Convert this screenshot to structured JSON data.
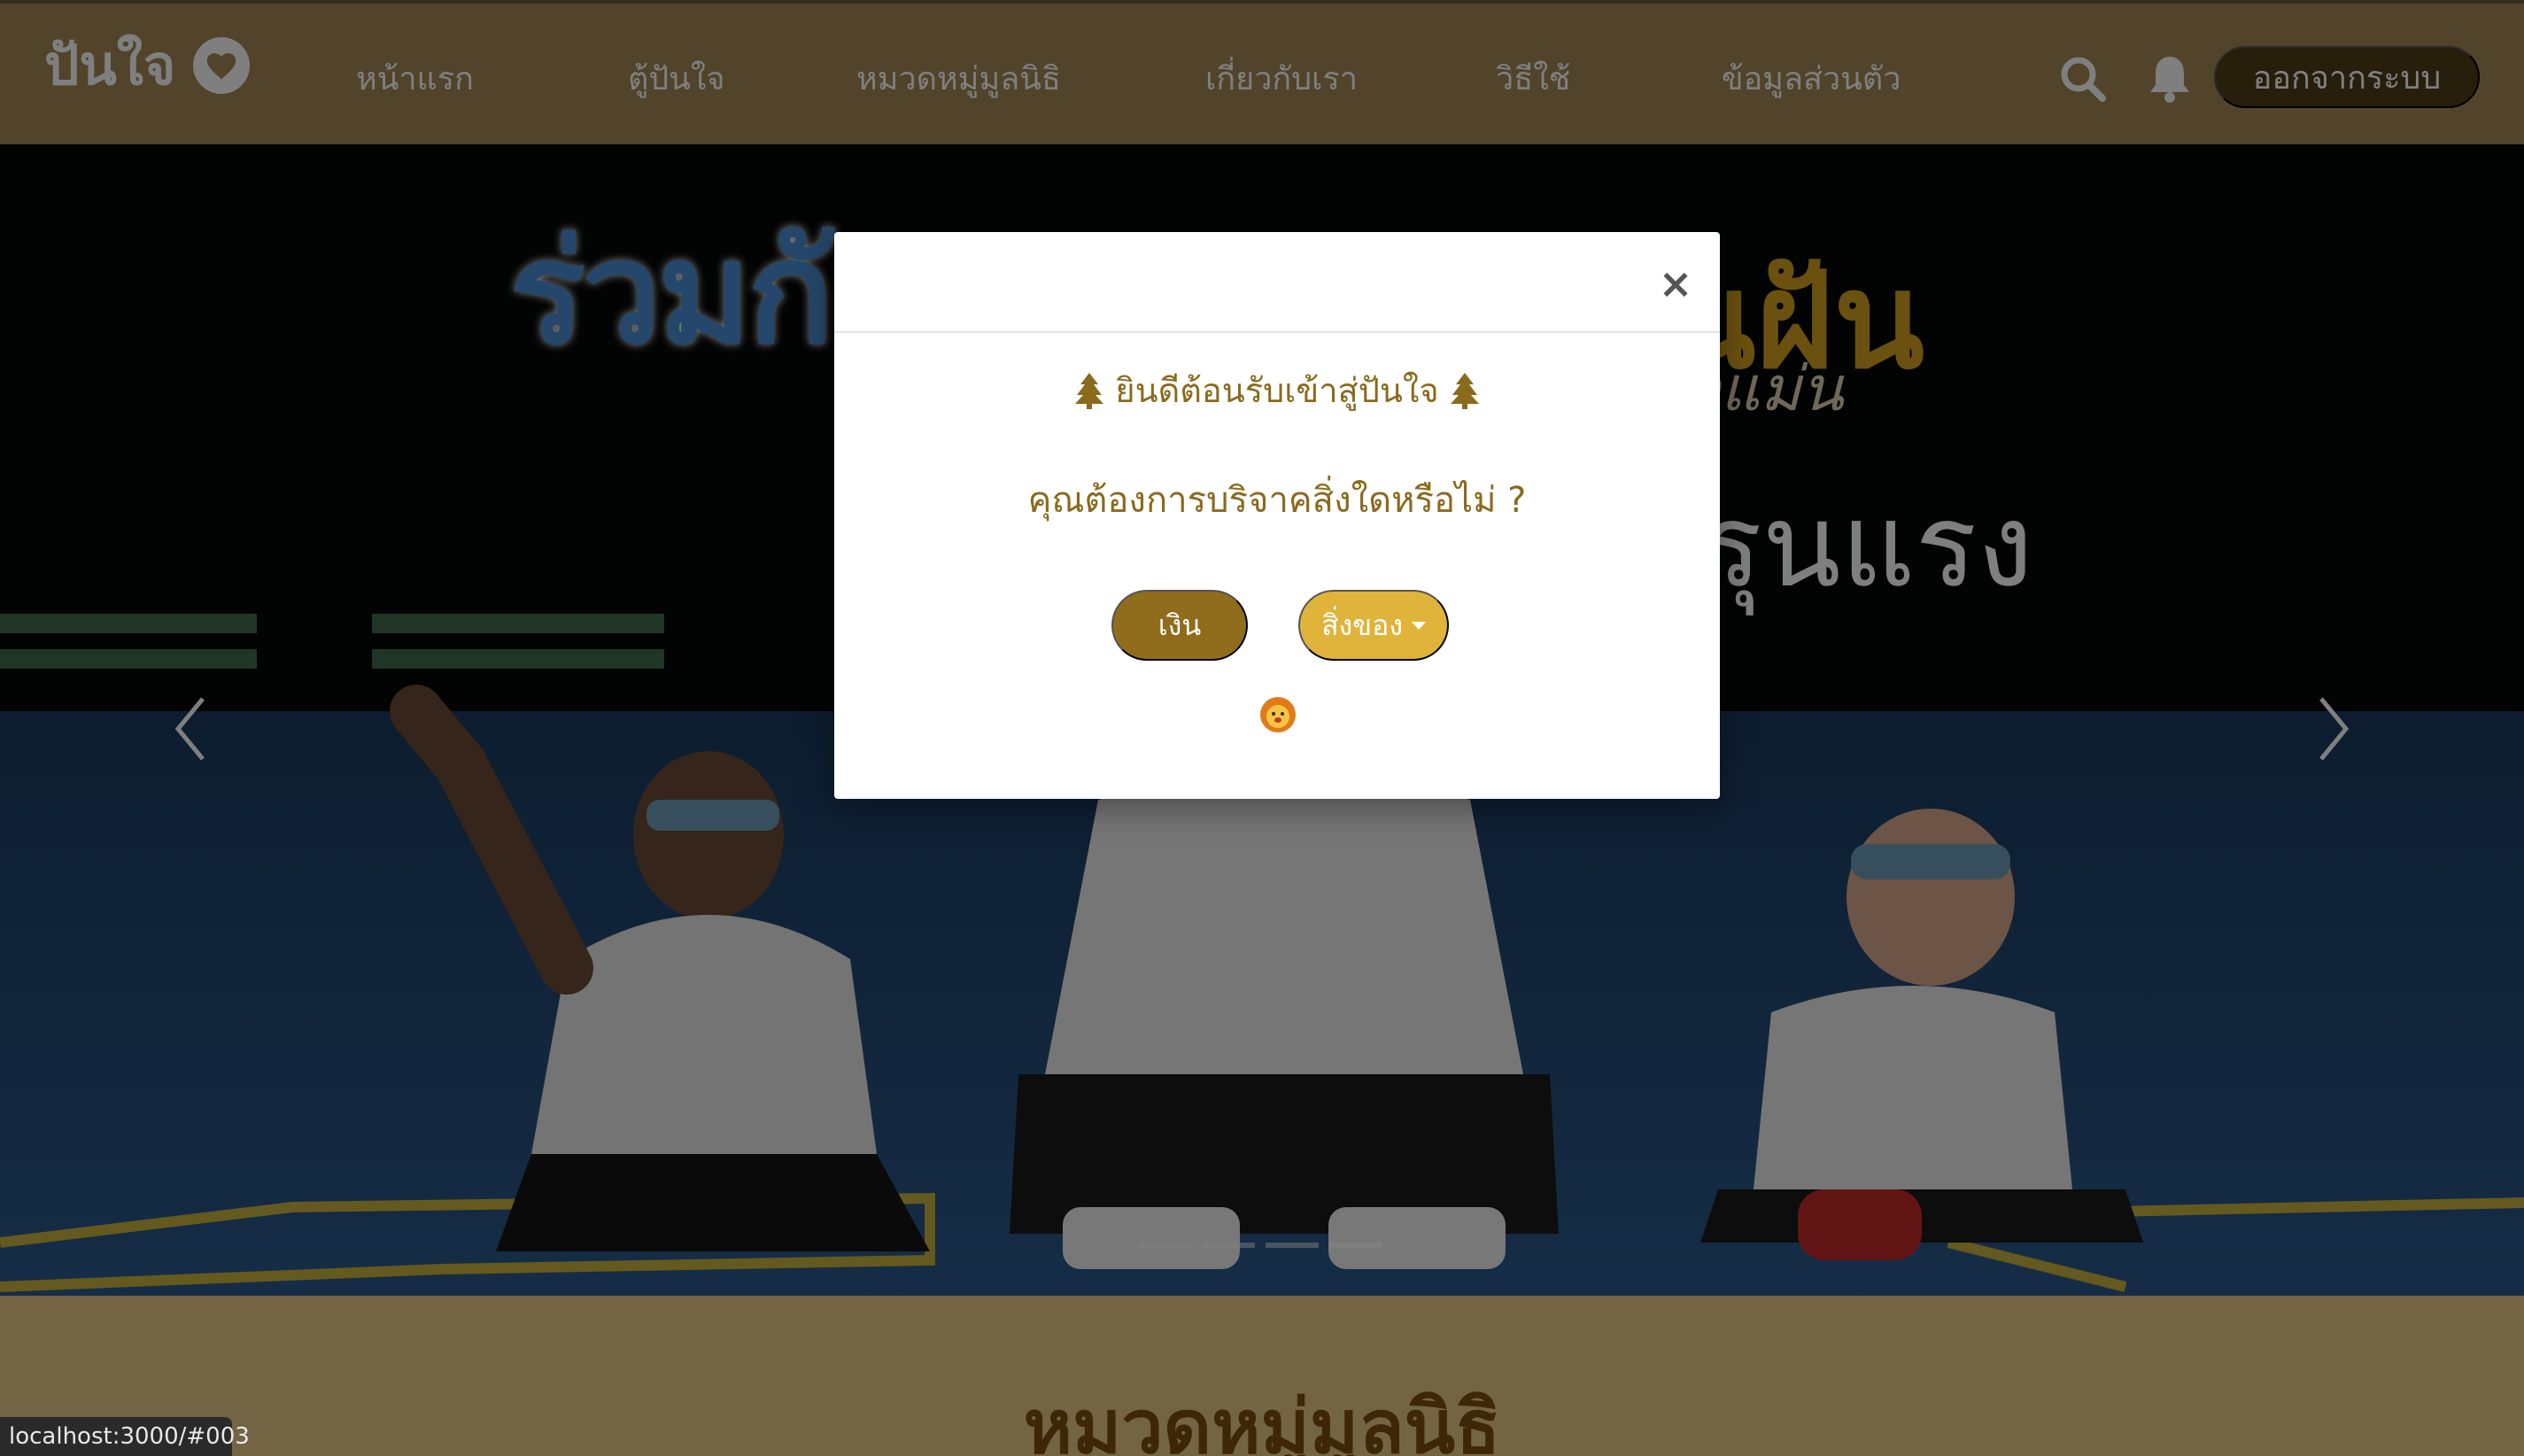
{
  "navbar": {
    "brand": "ปันใจ",
    "links": [
      "หน้าแรก",
      "ตู้ปันใจ",
      "หมวดหมู่มูลนิธิ",
      "เกี่ยวกับเรา",
      "วิธีใช้",
      "ข้อมูลส่วนตัว"
    ],
    "logout_label": "ออกจากระบบ"
  },
  "carousel": {
    "title_1": "ร่วมกั",
    "title_2": "นฝัน",
    "subtitle_1": "กแม่น",
    "subtitle_2": "รุนแรง",
    "slide_count": 4,
    "active_slide": 4
  },
  "section": {
    "heading": "หมวดหมู่มูลนิธิ"
  },
  "modal": {
    "welcome": "ยินดีต้อนรับเข้าสู่ปันใจ",
    "question": "คุณต้องการบริจาคสิ่งใดหรือไม่ ?",
    "money_button": "เงิน",
    "items_button": "สิ่งของ",
    "close_symbol": "×"
  },
  "status_bar": {
    "url": "localhost:3000/#003"
  },
  "colors": {
    "navbar_bg": "#a38854",
    "logout_bg": "#4e3d17",
    "modal_text": "#8a6a1c",
    "money_btn": "#8f6d1c",
    "items_btn": "#e0b43a"
  }
}
